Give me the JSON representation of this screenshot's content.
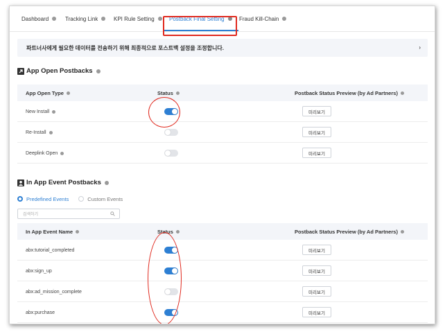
{
  "tabs": [
    {
      "label": "Dashboard"
    },
    {
      "label": "Tracking Link"
    },
    {
      "label": "KPI Rule Setting"
    },
    {
      "label": "Postback Final Setting"
    },
    {
      "label": "Fraud Kill-Chain"
    }
  ],
  "banner": {
    "text": "파트너사에게 필요한 데이터를 전송하기 위해 최종적으로 포스트백 설정을 조정합니다.",
    "chevron": "›"
  },
  "app_open": {
    "title": "App Open Postbacks",
    "columns": {
      "type": "App Open Type",
      "status": "Status",
      "preview": "Postback Status Preview (by Ad Partners)"
    },
    "rows": [
      {
        "name": "New Install",
        "enabled": true,
        "preview_label": "미리보기"
      },
      {
        "name": "Re-Install",
        "enabled": false,
        "preview_label": "미리보기"
      },
      {
        "name": "Deeplink Open",
        "enabled": false,
        "preview_label": "미리보기"
      }
    ]
  },
  "in_app": {
    "title": "In App Event Postbacks",
    "radio": {
      "predefined": "Predefined Events",
      "custom": "Custom Events",
      "selected": "predefined"
    },
    "search": {
      "placeholder": "검색하기"
    },
    "columns": {
      "name": "In App Event Name",
      "status": "Status",
      "preview": "Postback Status Preview (by Ad Partners)"
    },
    "rows": [
      {
        "name": "abx:tutorial_completed",
        "enabled": true,
        "preview_label": "미리보기"
      },
      {
        "name": "abx:sign_up",
        "enabled": true,
        "preview_label": "미리보기"
      },
      {
        "name": "abx:ad_mission_complete",
        "enabled": false,
        "preview_label": "미리보기"
      },
      {
        "name": "abx:purchase",
        "enabled": true,
        "preview_label": "미리보기"
      }
    ]
  },
  "colors": {
    "accent": "#2d7fd3",
    "annotation": "#e0281d",
    "header_bg": "#f3f5f9"
  }
}
